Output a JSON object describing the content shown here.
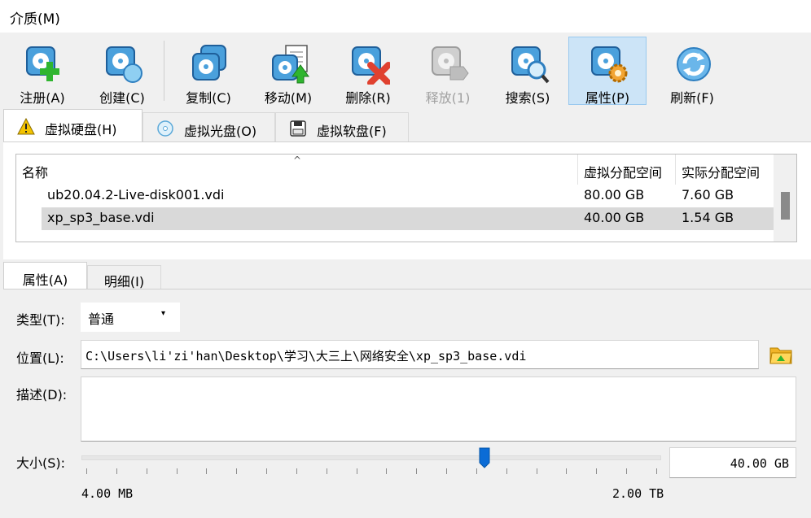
{
  "menubar": {
    "media_label": "介质(M)"
  },
  "toolbar": {
    "buttons": [
      {
        "label": "注册(A)",
        "icon": "disk-add-icon",
        "state": "normal"
      },
      {
        "label": "创建(C)",
        "icon": "disk-create-icon",
        "state": "normal"
      },
      {
        "label": "复制(C)",
        "icon": "disk-copy-icon",
        "state": "normal"
      },
      {
        "label": "移动(M)",
        "icon": "disk-move-icon",
        "state": "normal"
      },
      {
        "label": "删除(R)",
        "icon": "disk-remove-icon",
        "state": "normal"
      },
      {
        "label": "释放(1)",
        "icon": "disk-release-icon",
        "state": "disabled"
      },
      {
        "label": "搜索(S)",
        "icon": "disk-search-icon",
        "state": "normal"
      },
      {
        "label": "属性(P)",
        "icon": "disk-properties-icon",
        "state": "active"
      },
      {
        "label": "刷新(F)",
        "icon": "refresh-icon",
        "state": "normal"
      }
    ]
  },
  "media_tabs": [
    {
      "label": "虚拟硬盘(H)",
      "icon": "warning-icon",
      "selected": true
    },
    {
      "label": "虚拟光盘(O)",
      "icon": "optical-disc-icon",
      "selected": false
    },
    {
      "label": "虚拟软盘(F)",
      "icon": "floppy-icon",
      "selected": false
    }
  ],
  "table": {
    "columns": {
      "name": "名称",
      "virtual_size": "虚拟分配空间",
      "actual_size": "实际分配空间"
    },
    "sort_indicator": "^",
    "rows": [
      {
        "name": "ub20.04.2-Live-disk001.vdi",
        "virtual_size": "80.00 GB",
        "actual_size": "7.60 GB",
        "selected": false
      },
      {
        "name": "xp_sp3_base.vdi",
        "virtual_size": "40.00 GB",
        "actual_size": "1.54 GB",
        "selected": true
      }
    ]
  },
  "properties": {
    "tabs": [
      {
        "label": "属性(A)",
        "selected": true
      },
      {
        "label": "明细(I)",
        "selected": false
      }
    ],
    "type_label": "类型(T):",
    "type_value": "普通",
    "type_caret": "▾",
    "location_label": "位置(L):",
    "location_value": "C:\\Users\\li'zi'han\\Desktop\\学习\\大三上\\网络安全\\xp_sp3_base.vdi",
    "description_label": "描述(D):",
    "description_value": "",
    "size_label": "大小(S):",
    "size_min_label": "4.00 MB",
    "size_max_label": "2.00 TB",
    "size_value": "40.00 GB",
    "size_slider_fraction": 0.695
  },
  "colors": {
    "active_button_bg": "#cce4f7",
    "selected_row_bg": "#d9d9d9",
    "slider_handle": "#0b6cd6",
    "disk_blue": "#4aa0dc"
  }
}
